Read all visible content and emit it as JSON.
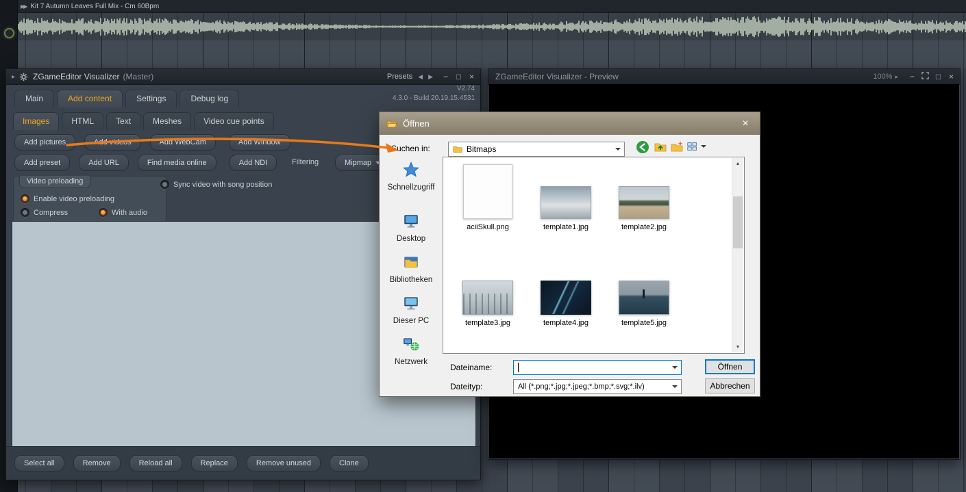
{
  "icons": {
    "track_marker": "▶▶",
    "detach": "▸",
    "prev": "◀",
    "next": "▶",
    "caret_right": "▸",
    "minimize": "−",
    "maximize": "□",
    "close": "×",
    "scroll_up": "▲",
    "scroll_down": "▼"
  },
  "playlist": {
    "track_title": "Kit 7 Autumn Leaves Full Mix - Cm 60Bpm"
  },
  "plugin": {
    "title": "ZGameEditor Visualizer",
    "title_suffix": "(Master)",
    "presets_label": "Presets",
    "version": "V2.74",
    "build": "4.3.0 - Build 20.19.15.4531",
    "tabs": [
      "Main",
      "Add content",
      "Settings",
      "Debug log"
    ],
    "subtabs": [
      "Images",
      "HTML",
      "Text",
      "Meshes",
      "Video cue points"
    ],
    "add_buttons_row1": [
      "Add pictures",
      "Add videos",
      "Add WebCam",
      "Add Window"
    ],
    "add_buttons_row2": [
      "Add preset",
      "Add URL",
      "Find media online",
      "Add NDI"
    ],
    "filtering_label": "Filtering",
    "mipmap_label": "Mipmap",
    "preload_group_label": "Video preloading",
    "radio_enable": "Enable video preloading",
    "radio_compress": "Compress",
    "radio_with_audio": "With audio",
    "radio_sync": "Sync video with song position",
    "bottom_buttons": [
      "Select all",
      "Remove",
      "Reload all",
      "Replace",
      "Remove unused",
      "Clone"
    ]
  },
  "preview": {
    "title": "ZGameEditor Visualizer - Preview",
    "zoom": "100%"
  },
  "dialog": {
    "title": "Öffnen",
    "look_in_label": "Suchen in:",
    "look_in_value": "Bitmaps",
    "sidebar": [
      "Schnellzugriff",
      "Desktop",
      "Bibliotheken",
      "Dieser PC",
      "Netzwerk"
    ],
    "files": [
      {
        "name": "aciiSkull.png"
      },
      {
        "name": "template1.jpg"
      },
      {
        "name": "template2.jpg"
      },
      {
        "name": "template3.jpg"
      },
      {
        "name": "template4.jpg"
      },
      {
        "name": "template5.jpg"
      }
    ],
    "filename_label": "Dateiname:",
    "filename_value": "",
    "filetype_label": "Dateityp:",
    "filetype_value": "All (*.png;*.jpg;*.jpeg;*.bmp;*.svg;*.ilv)",
    "open_label": "Öffnen",
    "cancel_label": "Abbrechen"
  }
}
